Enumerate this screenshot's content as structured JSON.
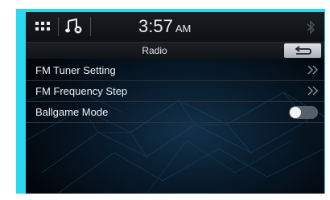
{
  "status_bar": {
    "time": "3:57",
    "ampm": "AM"
  },
  "header": {
    "title": "Radio"
  },
  "menu": {
    "items": [
      {
        "label": "FM Tuner Setting"
      },
      {
        "label": "FM Frequency Step"
      },
      {
        "label": "Ballgame Mode"
      }
    ]
  },
  "colors": {
    "frame": "#2ad8f0",
    "screen_bg": "#03070c"
  },
  "icons": {
    "apps": "grid-icon",
    "music": "music-note-icon",
    "bluetooth": "bluetooth-icon",
    "back": "back-arrow-icon",
    "chevron": "double-chevron-right-icon"
  },
  "ballgame_mode_enabled": false
}
